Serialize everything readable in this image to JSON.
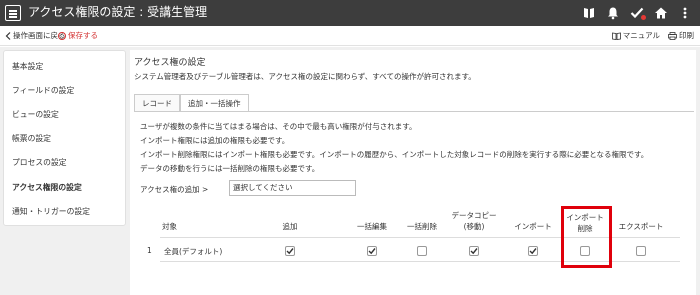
{
  "header": {
    "title": "アクセス権限の設定 : 受講生管理",
    "icons": [
      "menu-icon",
      "book-icon",
      "bell-icon",
      "check-icon",
      "home-icon",
      "more-icon"
    ]
  },
  "subbar": {
    "back_label": "操作画面に戻る",
    "save_label": "保存する",
    "manual_label": "マニュアル",
    "print_label": "印刷"
  },
  "sidebar": {
    "items": [
      {
        "label": "基本設定",
        "active": false
      },
      {
        "label": "フィールドの設定",
        "active": false
      },
      {
        "label": "ビューの設定",
        "active": false
      },
      {
        "label": "帳票の設定",
        "active": false
      },
      {
        "label": "プロセスの設定",
        "active": false
      },
      {
        "label": "アクセス権限の設定",
        "active": true
      },
      {
        "label": "通知・トリガーの設定",
        "active": false
      }
    ]
  },
  "main": {
    "title": "アクセス権の設定",
    "description": "システム管理者及びテーブル管理者は、アクセス権の設定に関わらず、すべての操作が許可されます。",
    "tabs": [
      {
        "label": "レコード",
        "active": false
      },
      {
        "label": "追加・一括操作",
        "active": true
      }
    ],
    "notes": [
      "ユーザが複数の条件に当てはまる場合は、その中で最も高い権限が付与されます。",
      "インポート権限には追加の権限も必要です。",
      "インポート削除権限にはインポート権限も必要です。インポートの履歴から、インポートした対象レコードの削除を実行する際に必要となる権限です。",
      "データの移動を行うには一括削除の権限も必要です。"
    ],
    "add_label": "アクセス権の追加 >",
    "add_placeholder": "選択してください",
    "table": {
      "headers": {
        "target": "対象",
        "add": "追加",
        "bulk_edit": "一括編集",
        "bulk_delete": "一括削除",
        "data_copy_1": "データコピー",
        "data_copy_2": "(移動)",
        "import": "インポート",
        "import_delete_1": "インポート",
        "import_delete_2": "削除",
        "export": "エクスポート"
      },
      "rows": [
        {
          "index": "1",
          "target": "全員(デフォルト)",
          "add": true,
          "bulk_edit": true,
          "bulk_delete": false,
          "data_copy": true,
          "import": true,
          "import_delete": false,
          "export": false
        }
      ]
    }
  },
  "colors": {
    "topbar": "#3d3d3d",
    "save": "#d32f2f",
    "highlight": "#e0000b",
    "background": "#f0f0f0"
  }
}
